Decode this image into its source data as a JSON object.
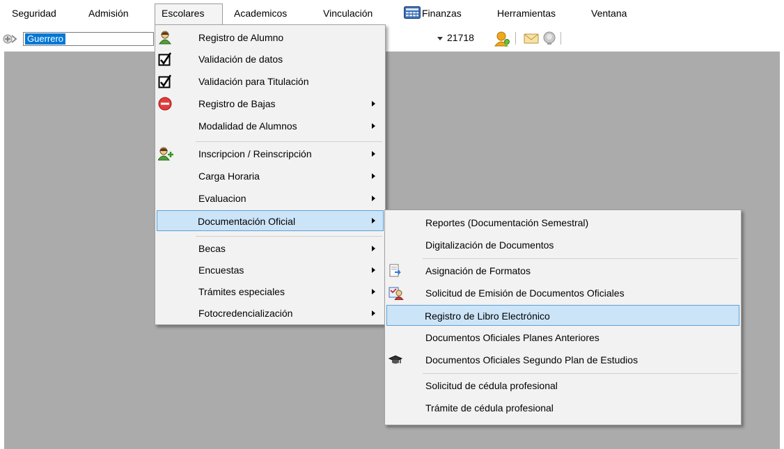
{
  "menubar": {
    "items": [
      {
        "label": "Seguridad"
      },
      {
        "label": "Admisión"
      },
      {
        "label": "Escolares"
      },
      {
        "label": "Academicos"
      },
      {
        "label": "Vinculación"
      },
      {
        "label": "Finanzas",
        "icon": "calculator-icon"
      },
      {
        "label": "Herramientas"
      },
      {
        "label": "Ventana"
      }
    ]
  },
  "toolbar": {
    "combo_value": "Guerrero",
    "id_value": "21718"
  },
  "escolares_menu": {
    "items": [
      {
        "label": "Registro de Alumno",
        "icon": "student-icon",
        "submenu": false
      },
      {
        "label": "Validación de datos",
        "icon": "checkbox-checked-icon",
        "submenu": false
      },
      {
        "label": "Validación para Titulación",
        "icon": "checkbox-checked-icon",
        "submenu": false
      },
      {
        "label": "Registro de Bajas",
        "icon": "remove-icon",
        "submenu": true
      },
      {
        "label": "Modalidad de Alumnos",
        "submenu": true
      },
      {
        "label": "Inscripcion / Reinscripción",
        "icon": "add-student-icon",
        "submenu": true
      },
      {
        "label": "Carga Horaria",
        "submenu": true
      },
      {
        "label": "Evaluacion",
        "submenu": true
      },
      {
        "label": "Documentación Oficial",
        "submenu": true,
        "highlighted": true
      },
      {
        "label": "Becas",
        "submenu": true
      },
      {
        "label": "Encuestas",
        "submenu": true
      },
      {
        "label": "Trámites especiales",
        "submenu": true
      },
      {
        "label": "Fotocredencialización",
        "submenu": true
      }
    ]
  },
  "documentacion_submenu": {
    "items": [
      {
        "label": "Reportes (Documentación Semestral)"
      },
      {
        "label": "Digitalización de Documentos"
      },
      {
        "label": "Asignación de Formatos",
        "icon": "document-arrow-icon"
      },
      {
        "label": "Solicitud de Emisión de Documentos Oficiales",
        "icon": "document-person-icon"
      },
      {
        "label": "Registro de Libro Electrónico",
        "highlighted": true
      },
      {
        "label": "Documentos Oficiales Planes Anteriores"
      },
      {
        "label": "Documentos Oficiales Segundo Plan de Estudios",
        "icon": "graduation-cap-icon"
      },
      {
        "label": "Solicitud de cédula profesional"
      },
      {
        "label": "Trámite de cédula profesional"
      }
    ]
  },
  "colors": {
    "highlight_bg": "#cce4f7",
    "highlight_border": "#5ea0d6",
    "workspace": "#ababab",
    "selection": "#0078d7"
  }
}
